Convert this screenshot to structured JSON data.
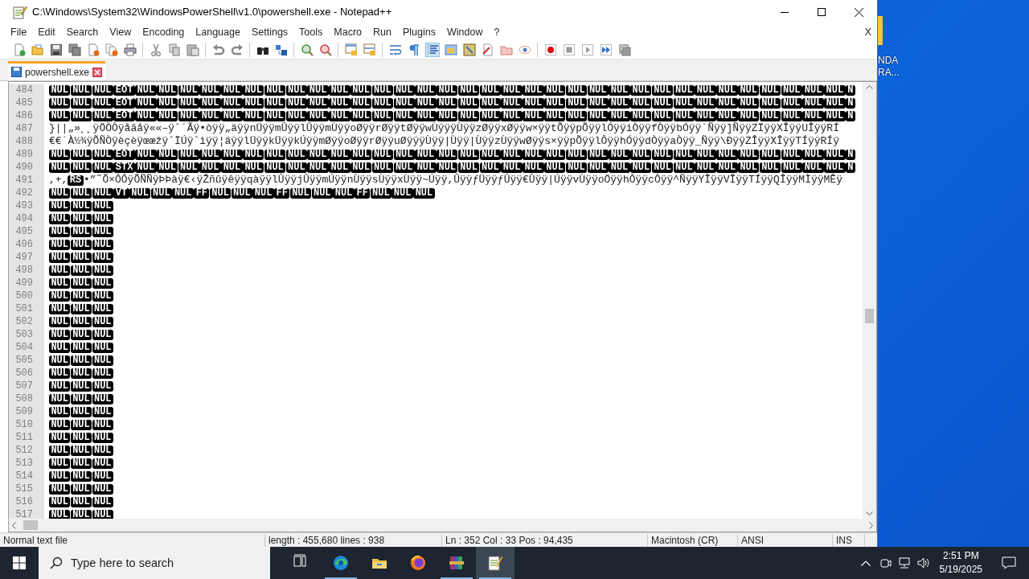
{
  "window": {
    "title": "C:\\Windows\\System32\\WindowsPowerShell\\v1.0\\powershell.exe - Notepad++"
  },
  "menu": [
    "File",
    "Edit",
    "Search",
    "View",
    "Encoding",
    "Language",
    "Settings",
    "Tools",
    "Macro",
    "Run",
    "Plugins",
    "Window",
    "?"
  ],
  "menu_close": "X",
  "tabs": [
    {
      "label": "powershell.exe",
      "selected": true
    }
  ],
  "editor": {
    "lines": [
      {
        "number": "484",
        "segments": [
          {
            "kind": "ctrl",
            "text": "NUL NUL NUL EOT NUL NUL NUL NUL NUL NUL NUL NUL NUL NUL NUL NUL NUL NUL NUL NUL NUL NUL NUL NUL NUL NUL NUL NUL NUL NUL NUL NUL NUL NUL NUL NUL NUL N"
          }
        ]
      },
      {
        "number": "485",
        "segments": [
          {
            "kind": "ctrl",
            "text": "NUL NUL NUL EOT NUL NUL NUL NUL NUL NUL NUL NUL NUL NUL NUL NUL NUL NUL NUL NUL NUL NUL NUL NUL NUL NUL NUL NUL NUL NUL NUL NUL NUL NUL NUL NUL NUL N"
          }
        ]
      },
      {
        "number": "486",
        "segments": [
          {
            "kind": "ctrl",
            "text": "NUL NUL NUL EOT NUL NUL NUL NUL NUL NUL NUL NUL NUL NUL NUL NUL NUL NUL NUL NUL NUL NUL NUL NUL NUL NUL NUL NUL NUL NUL NUL NUL NUL NUL NUL NUL NUL N"
          }
        ]
      },
      {
        "number": "487",
        "segments": [
          {
            "kind": "text",
            "text": "}||„»¸¸ÿÖÒÒÿåãåÿ««–ÿˆ´Ãÿ•òÿÿ„äÿÿnÜÿÿmÛÿÿlÛÿÿmÙÿÿoØÿÿrØÿÿtØÿÿwÙÿÿÿÙÿÿzØÿÿxØÿÿw×ÿÿtÕÿÿpÕÿÿlÓÿÿiÒÿÿfÒÿÿbÓÿÿ`Ñÿÿ]ÑÿÿZÏÿÿXÎÿÿUÎÿÿRÍ"
          }
        ]
      },
      {
        "number": "488",
        "segments": [
          {
            "kind": "text",
            "text": "€€`À½¾ÿÕÑÒÿèçèÿœæžÿˆÏÚÿˆìÿÿ¦äÿÿlÜÿÿkÜÿÿkÚÿÿmØÿÿoØÿÿrØÿÿuØÿÿÿÙÿÿ|Ùÿÿ|ÙÿÿzÙÿÿwØÿÿs×ÿÿpÕÿÿlÔÿÿhÓÿÿdÒÿÿaÒÿÿ_Ñÿÿ\\ÐÿÿZÎÿÿXÎÿÿTÍÿÿRÍÿ"
          }
        ]
      },
      {
        "number": "489",
        "segments": [
          {
            "kind": "ctrl",
            "text": "NUL NUL NUL EOT NUL NUL NUL NUL NUL NUL NUL NUL NUL NUL NUL NUL NUL NUL NUL NUL NUL NUL NUL NUL NUL NUL NUL NUL NUL NUL NUL NUL NUL NUL NUL NUL NUL N"
          }
        ]
      },
      {
        "number": "490",
        "segments": [
          {
            "kind": "ctrl",
            "text": "NUL NUL NUL STX NUL NUL NUL NUL NUL NUL NUL NUL NUL NUL NUL NUL NUL NUL NUL NUL NUL NUL NUL NUL NUL NUL NUL NUL NUL NUL NUL NUL NUL NUL NUL NUL NUL N"
          }
        ]
      },
      {
        "number": "491",
        "segments": [
          {
            "kind": "text",
            "text": ",+,"
          },
          {
            "kind": "ctrl",
            "text": "RS"
          },
          {
            "kind": "text",
            "text": "•”˜Õ×ÔÔÿÕÑÑÿÞÞàÿ€‹ÿŽñûÿêÿÿqàÿÿlÛÿÿjÛÿÿmÚÿÿnÙÿÿsÙÿÿxÙÿÿ~Úÿÿ,ÛÿÿƒÜÿÿƒÛÿÿ€Ûÿÿ|ÚÿÿvÙÿÿoÖÿÿhÔÿÿcÔÿÿ^ÑÿÿYÎÿÿVÎÿÿTÍÿÿQÎÿÿMÌÿÿMÊÿ"
          }
        ]
      },
      {
        "number": "492",
        "segments": [
          {
            "kind": "ctrl",
            "text": "NUL NUL NUL VT NUL NUL NUL FF NUL NUL NUL FF NUL NUL NUL FF NUL NUL NUL"
          }
        ]
      },
      {
        "number": "493",
        "segments": [
          {
            "kind": "ctrl",
            "text": "NUL NUL NUL"
          }
        ]
      },
      {
        "number": "494",
        "segments": [
          {
            "kind": "ctrl",
            "text": "NUL NUL NUL"
          }
        ]
      },
      {
        "number": "495",
        "segments": [
          {
            "kind": "ctrl",
            "text": "NUL NUL NUL"
          }
        ]
      },
      {
        "number": "496",
        "segments": [
          {
            "kind": "ctrl",
            "text": "NUL NUL NUL"
          }
        ]
      },
      {
        "number": "497",
        "segments": [
          {
            "kind": "ctrl",
            "text": "NUL NUL NUL"
          }
        ]
      },
      {
        "number": "498",
        "segments": [
          {
            "kind": "ctrl",
            "text": "NUL NUL NUL"
          }
        ]
      },
      {
        "number": "499",
        "segments": [
          {
            "kind": "ctrl",
            "text": "NUL NUL NUL"
          }
        ]
      },
      {
        "number": "500",
        "segments": [
          {
            "kind": "ctrl",
            "text": "NUL NUL NUL"
          }
        ]
      },
      {
        "number": "501",
        "segments": [
          {
            "kind": "ctrl",
            "text": "NUL NUL NUL"
          }
        ]
      },
      {
        "number": "502",
        "segments": [
          {
            "kind": "ctrl",
            "text": "NUL NUL NUL"
          }
        ]
      },
      {
        "number": "503",
        "segments": [
          {
            "kind": "ctrl",
            "text": "NUL NUL NUL"
          }
        ]
      },
      {
        "number": "504",
        "segments": [
          {
            "kind": "ctrl",
            "text": "NUL NUL NUL"
          }
        ]
      },
      {
        "number": "505",
        "segments": [
          {
            "kind": "ctrl",
            "text": "NUL NUL NUL"
          }
        ]
      },
      {
        "number": "506",
        "segments": [
          {
            "kind": "ctrl",
            "text": "NUL NUL NUL"
          }
        ]
      },
      {
        "number": "507",
        "segments": [
          {
            "kind": "ctrl",
            "text": "NUL NUL NUL"
          }
        ]
      },
      {
        "number": "508",
        "segments": [
          {
            "kind": "ctrl",
            "text": "NUL NUL NUL"
          }
        ]
      },
      {
        "number": "509",
        "segments": [
          {
            "kind": "ctrl",
            "text": "NUL NUL NUL"
          }
        ]
      },
      {
        "number": "510",
        "segments": [
          {
            "kind": "ctrl",
            "text": "NUL NUL NUL"
          }
        ]
      },
      {
        "number": "511",
        "segments": [
          {
            "kind": "ctrl",
            "text": "NUL NUL NUL"
          }
        ]
      },
      {
        "number": "512",
        "segments": [
          {
            "kind": "ctrl",
            "text": "NUL NUL NUL"
          }
        ]
      },
      {
        "number": "513",
        "segments": [
          {
            "kind": "ctrl",
            "text": "NUL NUL NUL"
          }
        ]
      },
      {
        "number": "514",
        "segments": [
          {
            "kind": "ctrl",
            "text": "NUL NUL NUL"
          }
        ]
      },
      {
        "number": "515",
        "segments": [
          {
            "kind": "ctrl",
            "text": "NUL NUL NUL"
          }
        ]
      },
      {
        "number": "516",
        "segments": [
          {
            "kind": "ctrl",
            "text": "NUL NUL NUL"
          }
        ]
      },
      {
        "number": "517",
        "segments": [
          {
            "kind": "ctrl",
            "text": "NUL NUL NUL"
          }
        ]
      }
    ]
  },
  "status_bar": [
    "Normal text file",
    "length : 455,680    lines : 938",
    "Ln : 352    Col : 33    Pos : 94,435",
    "Macintosh (CR)",
    "ANSI",
    "INS"
  ],
  "desktop_icon": {
    "label_lines": [
      "NDA",
      "RA..."
    ]
  },
  "taskbar": {
    "search": {
      "placeholder": "Type here to search"
    },
    "apps": [
      {
        "kind": "taskview",
        "running": false,
        "selected": false
      },
      {
        "kind": "edge",
        "running": true,
        "selected": false
      },
      {
        "kind": "explorer",
        "running": false,
        "selected": false
      },
      {
        "kind": "firefox",
        "running": false,
        "selected": false
      },
      {
        "kind": "winrar",
        "running": true,
        "selected": false
      },
      {
        "kind": "notepadpp",
        "running": true,
        "selected": true
      }
    ],
    "time": "2:51 PM",
    "date": "5/19/2025"
  }
}
